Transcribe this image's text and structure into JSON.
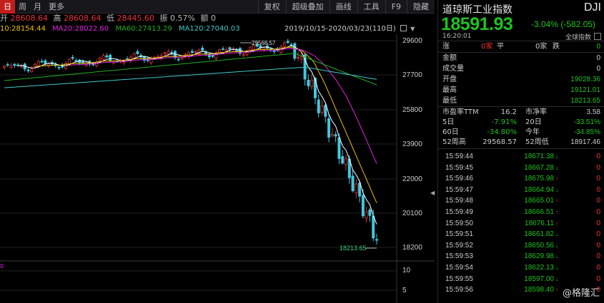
{
  "tabs": [
    "日",
    "周",
    "月",
    "更多"
  ],
  "menu": [
    "复权",
    "超级叠加",
    "画线",
    "工具",
    "F9",
    "隐藏"
  ],
  "ohlc": {
    "open_label": "开",
    "open": "28608.64",
    "high_label": "高",
    "high": "28608.64",
    "low_label": "低",
    "low": "28445.60",
    "amp_label": "振",
    "amp": "0.57%",
    "amt_label": "额",
    "amt": "0"
  },
  "ma": {
    "ma10": "10:28154.44",
    "ma20": "MA20:28022.60",
    "ma60": "MA60:27413.29",
    "ma120": "MA120:27040.03"
  },
  "date_range": "2019/10/15-2020/03/23(110日)",
  "y_labels": [
    "29600",
    "27700",
    "25800",
    "23900",
    "22000",
    "20100",
    "18200"
  ],
  "vol_labels": [
    "10",
    "5"
  ],
  "vol_left": "0",
  "high_mark": "29568.57",
  "low_mark": "18213.65",
  "colors": {
    "up": "#e33333",
    "down": "#1ec41e",
    "ma5": "#ffffff",
    "ma10": "#f0c000",
    "ma20": "#e020e0",
    "ma60": "#20b020",
    "ma120": "#40c8c8",
    "candle_down": "#40c8e0"
  },
  "panel": {
    "title": "道琼斯工业指数",
    "code": "DJI",
    "price": "18591.93",
    "change": "-3.04% (-582.05)",
    "time": "16:20:01",
    "tag": "全球指数",
    "updown": {
      "up_label": "涨",
      "up_val": "0家",
      "flat_label": "平",
      "flat_val": "0家",
      "down_label": "跌",
      "down_val": "0"
    },
    "rows": [
      {
        "label": "金额",
        "value": "0"
      },
      {
        "label": "成交量",
        "value": "0"
      },
      {
        "label": "开盘",
        "value": "19028.36"
      },
      {
        "label": "最高",
        "value": "19121.01"
      },
      {
        "label": "最低",
        "value": "18213.65"
      }
    ],
    "stats": [
      {
        "l1": "市盈率TTM",
        "v1": "16.2",
        "l2": "市净率",
        "v2": "3.58"
      },
      {
        "l1": "5日",
        "v1": "-7.91%",
        "l2": "20日",
        "v2": "-33.51%"
      },
      {
        "l1": "60日",
        "v1": "-34.80%",
        "l2": "今年",
        "v2": "-34.85%"
      },
      {
        "l1": "52周高",
        "v1": "29568.57",
        "l2": "52周低",
        "v2": "18917.46"
      }
    ],
    "ticks": [
      {
        "time": "15:59:44",
        "price": "18671.38",
        "dir": "dn",
        "vol": "0"
      },
      {
        "time": "15:59:45",
        "price": "18667.28",
        "dir": "dn",
        "vol": "0"
      },
      {
        "time": "15:59:46",
        "price": "18675.98",
        "dir": "up",
        "vol": "0"
      },
      {
        "time": "15:59:47",
        "price": "18664.94",
        "dir": "dn",
        "vol": "0"
      },
      {
        "time": "15:59:48",
        "price": "18665.01",
        "dir": "up",
        "vol": "0"
      },
      {
        "time": "15:59:49",
        "price": "18666.51",
        "dir": "up",
        "vol": "0"
      },
      {
        "time": "15:59:50",
        "price": "18676.11",
        "dir": "up",
        "vol": "0"
      },
      {
        "time": "15:59:51",
        "price": "18661.82",
        "dir": "dn",
        "vol": "0"
      },
      {
        "time": "15:59:52",
        "price": "18650.56",
        "dir": "dn",
        "vol": "0"
      },
      {
        "time": "15:59:53",
        "price": "18629.98",
        "dir": "dn",
        "vol": "0"
      },
      {
        "time": "15:59:54",
        "price": "18622.13",
        "dir": "dn",
        "vol": "0"
      },
      {
        "time": "15:59:55",
        "price": "18597.00",
        "dir": "dn",
        "vol": "0"
      },
      {
        "time": "15:59:56",
        "price": "18598.40",
        "dir": "up",
        "vol": "0"
      }
    ]
  },
  "watermark": "@格隆汇"
}
